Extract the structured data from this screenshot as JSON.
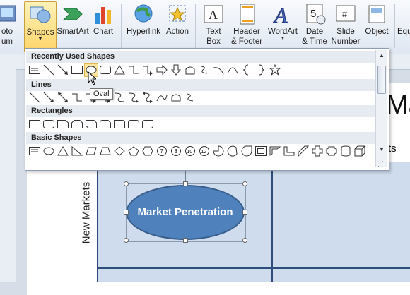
{
  "ribbon": {
    "buttons": [
      {
        "label": "oto\num"
      },
      {
        "label": "Shapes"
      },
      {
        "label": "SmartArt"
      },
      {
        "label": "Chart"
      },
      {
        "label": "Hyperlink"
      },
      {
        "label": "Action"
      },
      {
        "label": "Text\nBox"
      },
      {
        "label": "Header\n& Footer"
      },
      {
        "label": "WordArt"
      },
      {
        "label": "Date\n& Time"
      },
      {
        "label": "Slide\nNumber"
      },
      {
        "label": "Object"
      },
      {
        "label": "Equ"
      }
    ]
  },
  "gallery": {
    "sections": [
      {
        "title": "Recently Used Shapes"
      },
      {
        "title": "Lines"
      },
      {
        "title": "Rectangles"
      },
      {
        "title": "Basic Shapes"
      }
    ],
    "tooltip": "Oval"
  },
  "slide": {
    "title_partial": "Ma",
    "subtitle_partial": "ts",
    "row_label": "New Markets",
    "oval_text": "Market Penetration"
  },
  "colors": {
    "oval_fill": "#4f81bd",
    "grid_fill": "#cfdced",
    "grid_line": "#2f4d7a",
    "hover": "#fde6a0"
  }
}
